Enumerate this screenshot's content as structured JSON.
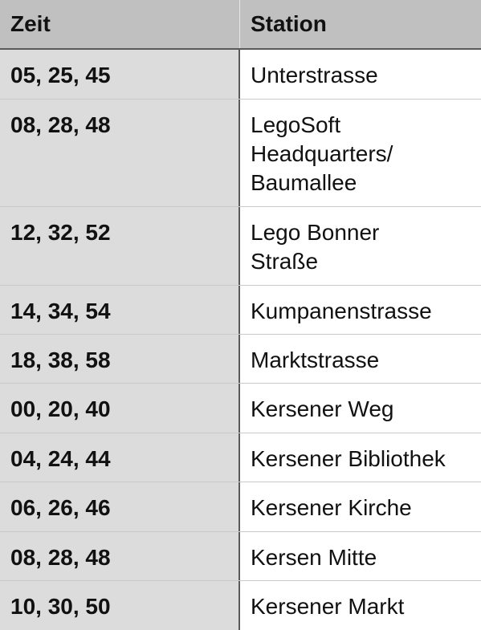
{
  "table": {
    "headers": {
      "zeit": "Zeit",
      "station": "Station"
    },
    "rows": [
      {
        "zeit": "05, 25, 45",
        "station": "Unterstrasse"
      },
      {
        "zeit": "08, 28, 48",
        "station": "LegoSoft Headquarters/ Baumallee"
      },
      {
        "zeit": "12, 32, 52",
        "station": "Lego Bonner Straße"
      },
      {
        "zeit": "14, 34, 54",
        "station": "Kumpanenstrasse"
      },
      {
        "zeit": "18, 38, 58",
        "station": "Marktstrasse"
      },
      {
        "zeit": "00, 20, 40",
        "station": "Kersener Weg"
      },
      {
        "zeit": "04, 24, 44",
        "station": "Kersener Bibliothek"
      },
      {
        "zeit": "06, 26, 46",
        "station": "Kersener Kirche"
      },
      {
        "zeit": "08, 28, 48",
        "station": "Kersen Mitte"
      },
      {
        "zeit": "10, 30, 50",
        "station": "Kersener Markt"
      }
    ]
  },
  "colors": {
    "header_bg": "#c0c0c0",
    "first_column_bg": "#dcdcdc",
    "divider": "#5a5a5a",
    "gridline": "#c9c9c9"
  }
}
